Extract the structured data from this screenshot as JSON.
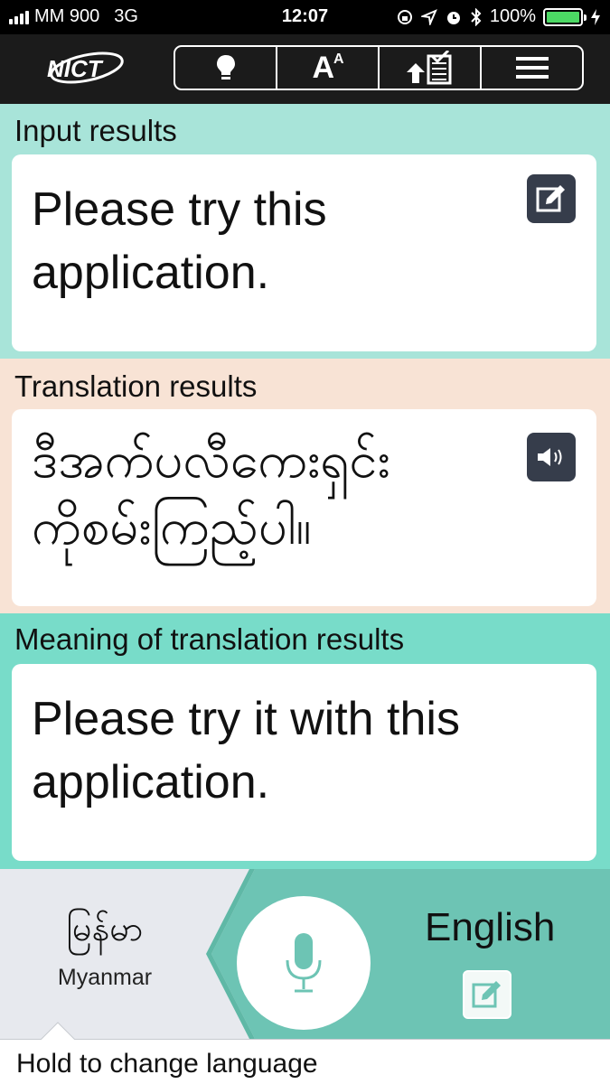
{
  "status_bar": {
    "carrier": "MM 900",
    "network": "3G",
    "time": "12:07",
    "battery": "100%",
    "battery_color": "#4cd964"
  },
  "toolbar": {
    "logo_text": "NICT",
    "buttons": [
      {
        "icon": "lightbulb-icon"
      },
      {
        "label": "A",
        "sup": "A",
        "icon": "font-size-icon"
      },
      {
        "icon": "upload-checklist-icon"
      },
      {
        "icon": "hamburger-menu-icon"
      }
    ]
  },
  "input_section": {
    "label": "Input results",
    "text_line1": "Please try this",
    "text_line2": "application.",
    "bg_color": "#a8e4d9",
    "action_icon": "edit-icon"
  },
  "translation_section": {
    "label": "Translation results",
    "text_line1": "ဒီအက်ပလီကေးရှင်း",
    "text_line2": "ကိုစမ်းကြည့်ပါ။",
    "bg_color": "#f8e3d5",
    "action_icon": "speaker-icon"
  },
  "meaning_section": {
    "label": "Meaning of translation results",
    "text_line1": "Please try it with this",
    "text_line2": "application.",
    "bg_color": "#78dcc9"
  },
  "bottom_bar": {
    "source_language_native": "မြန်မာ",
    "source_language": "Myanmar",
    "target_language": "English",
    "mic_icon": "microphone-icon",
    "edit_icon": "edit-icon",
    "accent_color": "#6dc4b4",
    "hint": "Hold to change language"
  }
}
